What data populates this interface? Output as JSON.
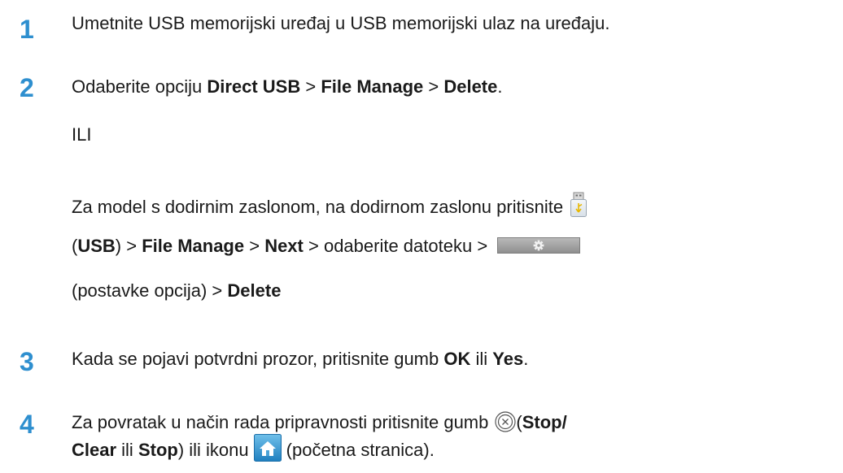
{
  "steps": [
    {
      "number": "1",
      "text": "Umetnite USB memorijski uređaj u USB memorijski ulaz na uređaju."
    },
    {
      "number": "2",
      "lead": "Odaberite opciju ",
      "menu1": "Direct USB",
      "sep": " > ",
      "menu2": "File Manage",
      "menu3": "Delete",
      "end": ".",
      "or_text": "ILI",
      "touch_intro": "Za model s dodirnim zaslonom, na dodirnom zaslonu pritisnite",
      "paren_open": "(",
      "usb_label": "USB",
      "paren_close": ")",
      "file_manage": "File Manage",
      "next": "Next",
      "choose_file": "odaberite datoteku",
      "options_text": "(postavke opcija)",
      "delete": "Delete"
    },
    {
      "number": "3",
      "lead": "Kada se pojavi potvrdni prozor, pritisnite gumb ",
      "ok": "OK",
      "or_word": " ili ",
      "yes": "Yes",
      "end": "."
    },
    {
      "number": "4",
      "lead": "Za povratak u način rada pripravnosti pritisnite gumb",
      "stop_clear_a": "Stop/",
      "stop_clear_b": "Clear",
      "or_word": " ili ",
      "stop": "Stop",
      "after_stop": ") ili ikonu",
      "home_text": "(početna stranica)."
    }
  ],
  "icons": {
    "usb": "usb-icon",
    "options": "gear-options-button",
    "stop": "stop-clear-icon",
    "home": "home-icon"
  },
  "colors": {
    "step_number": "#2e8fcf",
    "text": "#1a1a1a"
  }
}
